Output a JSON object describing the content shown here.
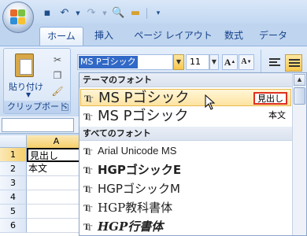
{
  "ribbon": {
    "tabs": [
      {
        "label": "ホーム",
        "active": true
      },
      {
        "label": "挿入",
        "active": false
      },
      {
        "label": "ページ レイアウト",
        "active": false
      },
      {
        "label": "数式",
        "active": false
      },
      {
        "label": "データ",
        "active": false
      }
    ],
    "clipboard": {
      "paste_label": "貼り付け",
      "group_label": "クリップボード",
      "paste_arrow": "▼"
    },
    "font": {
      "current_font": "MS Pゴシック",
      "current_size": "11",
      "grow_label": "A",
      "shrink_label": "A"
    }
  },
  "qat": {
    "icons": [
      "save-icon",
      "undo-icon",
      "redo-icon",
      "print-preview-icon",
      "open-icon",
      "customize-icon"
    ]
  },
  "namebox": {
    "value": ""
  },
  "grid": {
    "column_header": "A",
    "rows": [
      {
        "num": "1",
        "a": "見出し"
      },
      {
        "num": "2",
        "a": "本文"
      },
      {
        "num": "3",
        "a": ""
      },
      {
        "num": "4",
        "a": ""
      },
      {
        "num": "5",
        "a": ""
      },
      {
        "num": "6",
        "a": ""
      }
    ]
  },
  "font_gallery": {
    "theme_header": "テーマのフォント",
    "all_header": "すべてのフォント",
    "theme_fonts": [
      {
        "name": "MS Pゴシック",
        "tag": "見出し"
      },
      {
        "name": "MS Pゴシック",
        "tag": "本文"
      }
    ],
    "all_fonts": [
      {
        "name": "Arial Unicode MS"
      },
      {
        "name": "HGPゴシックE"
      },
      {
        "name": "HGPゴシックM"
      },
      {
        "name": "HGP教科書体"
      },
      {
        "name": "HGP行書体"
      }
    ]
  },
  "colors": {
    "accent": "#3169c6",
    "highlight": "#fde3a0",
    "tag_border": "#e03020"
  }
}
